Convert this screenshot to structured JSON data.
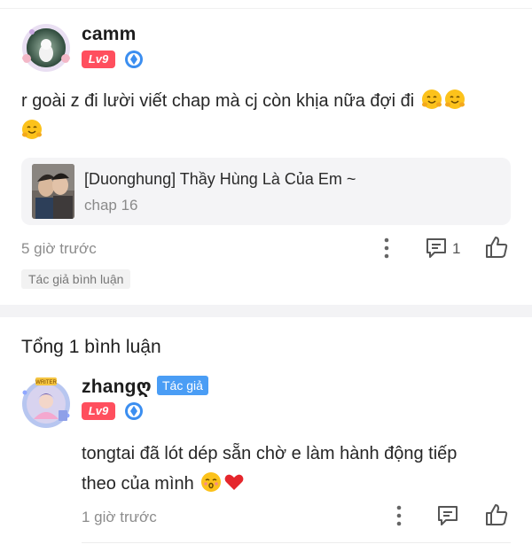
{
  "comment": {
    "username": "camm",
    "level": "Lv9",
    "text_line1": "r goài z đi lười viết chap mà cj còn khịa nữa đợi đi",
    "chapter_title": "[Duonghung] Thầy Hùng Là Của Em ~",
    "chapter_sub": "chap 16",
    "time": "5 giờ trước",
    "reply_count": "1",
    "author_tag": "Tác giả bình luận"
  },
  "replies": {
    "total_label": "Tổng 1 bình luận",
    "items": [
      {
        "username": "zhangღ",
        "badge": "Tác giả",
        "level": "Lv9",
        "text_line1": "tongtai đã lót dép sẵn chờ e làm hành động tiếp",
        "text_line2": "theo của mình",
        "time": "1 giờ trước",
        "avatar_frame_text": "WRITER"
      }
    ]
  },
  "colors": {
    "level_badge": "#ff4f5e",
    "author_badge": "#4a9df5",
    "gem": "#3b8ef0"
  },
  "icons": [
    "more-vertical-icon",
    "comment-icon",
    "like-icon",
    "hug-emoji-icon",
    "kiss-emoji-icon",
    "heart-emoji-icon",
    "gem-icon"
  ]
}
